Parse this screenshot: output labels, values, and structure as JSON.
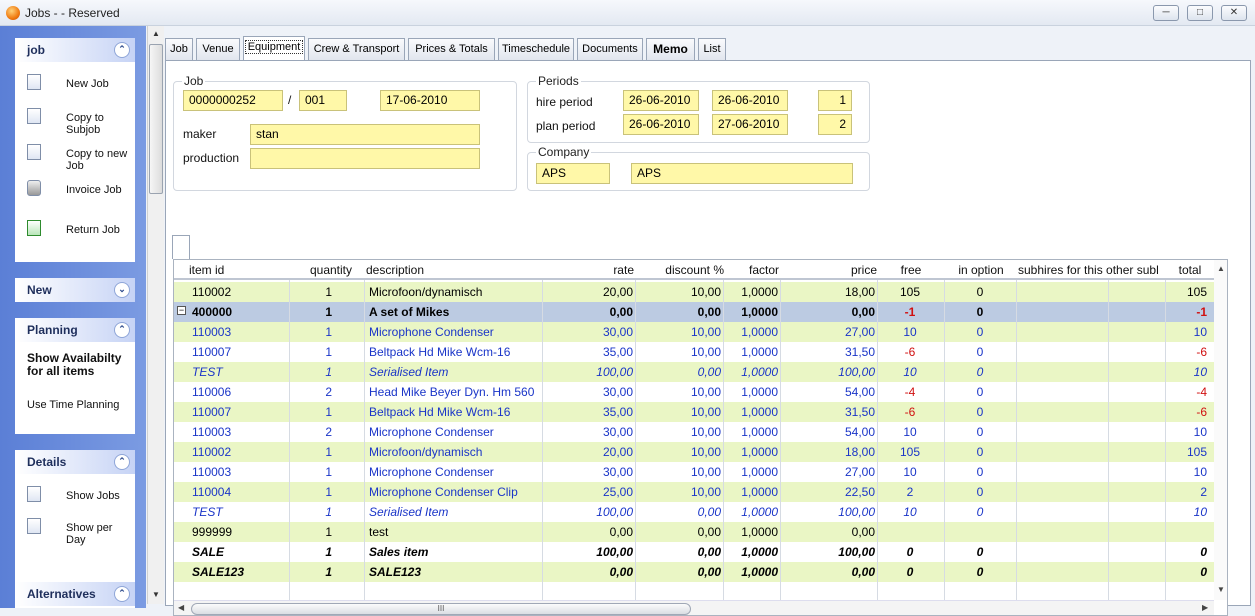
{
  "window": {
    "title": "Jobs -  - Reserved"
  },
  "taskpane": {
    "job": {
      "title": "job",
      "items": [
        "New Job",
        "Copy to Subjob",
        "Copy to new Job",
        "Invoice Job",
        "Return Job"
      ]
    },
    "new": {
      "title": "New"
    },
    "planning": {
      "title": "Planning",
      "show_availability": "Show Availabilty for all items",
      "use_time_planning": "Use Time Planning"
    },
    "details": {
      "title": "Details",
      "items": [
        "Show Jobs",
        "Show per Day"
      ]
    },
    "alternatives": {
      "title": "Alternatives"
    }
  },
  "tabs": [
    "Job",
    "Venue",
    "Equipment",
    "Crew & Transport",
    "Prices & Totals",
    "Timeschedule",
    "Documents",
    "Memo",
    "List"
  ],
  "active_tab": "Equipment",
  "job": {
    "group_label": "Job",
    "number": "0000000252",
    "separator": "/",
    "sub": "001",
    "date": "17-06-2010",
    "maker_label": "maker",
    "maker": "stan",
    "production_label": "production",
    "production": ""
  },
  "periods": {
    "group_label": "Periods",
    "hire_label": "hire period",
    "hire_from": "26-06-2010",
    "hire_to": "26-06-2010",
    "hire_days": "1",
    "plan_label": "plan period",
    "plan_from": "26-06-2010",
    "plan_to": "27-06-2010",
    "plan_days": "2"
  },
  "company": {
    "group_label": "Company",
    "code": "APS",
    "name": "APS"
  },
  "grid": {
    "columns": [
      "item id",
      "quantity",
      "description",
      "rate",
      "discount %",
      "factor",
      "price",
      "free",
      "in option",
      "subhires for this other subl",
      "total"
    ],
    "rows": [
      {
        "id": "110002",
        "qty": "1",
        "desc": "Microfoon/dynamisch",
        "rate": "20,00",
        "disc": "10,00",
        "factor": "1,0000",
        "price": "18,00",
        "free": "105",
        "opt": "0",
        "total": "105",
        "style": ""
      },
      {
        "id": "400000",
        "qty": "1",
        "desc": "A set of Mikes",
        "rate": "0,00",
        "disc": "0,00",
        "factor": "1,0000",
        "price": "0,00",
        "free": "-1",
        "opt": "0",
        "total": "-1",
        "style": "sel b"
      },
      {
        "id": "110003",
        "qty": "1",
        "desc": "Microphone Condenser",
        "rate": "30,00",
        "disc": "10,00",
        "factor": "1,0000",
        "price": "27,00",
        "free": "10",
        "opt": "0",
        "total": "10",
        "style": "blue"
      },
      {
        "id": "110007",
        "qty": "1",
        "desc": "Beltpack Hd Mike Wcm-16",
        "rate": "35,00",
        "disc": "10,00",
        "factor": "1,0000",
        "price": "31,50",
        "free": "-6",
        "opt": "0",
        "total": "-6",
        "style": "blue"
      },
      {
        "id": "TEST",
        "qty": "1",
        "desc": "Serialised Item",
        "rate": "100,00",
        "disc": "0,00",
        "factor": "1,0000",
        "price": "100,00",
        "free": "10",
        "opt": "0",
        "total": "10",
        "style": "blue ital"
      },
      {
        "id": "110006",
        "qty": "2",
        "desc": "Head Mike Beyer Dyn. Hm 560",
        "rate": "30,00",
        "disc": "10,00",
        "factor": "1,0000",
        "price": "54,00",
        "free": "-4",
        "opt": "0",
        "total": "-4",
        "style": "blue"
      },
      {
        "id": "110007",
        "qty": "1",
        "desc": "Beltpack Hd Mike Wcm-16",
        "rate": "35,00",
        "disc": "10,00",
        "factor": "1,0000",
        "price": "31,50",
        "free": "-6",
        "opt": "0",
        "total": "-6",
        "style": "blue"
      },
      {
        "id": "110003",
        "qty": "2",
        "desc": "Microphone Condenser",
        "rate": "30,00",
        "disc": "10,00",
        "factor": "1,0000",
        "price": "54,00",
        "free": "10",
        "opt": "0",
        "total": "10",
        "style": "blue"
      },
      {
        "id": "110002",
        "qty": "1",
        "desc": "Microfoon/dynamisch",
        "rate": "20,00",
        "disc": "10,00",
        "factor": "1,0000",
        "price": "18,00",
        "free": "105",
        "opt": "0",
        "total": "105",
        "style": "blue"
      },
      {
        "id": "110003",
        "qty": "1",
        "desc": "Microphone Condenser",
        "rate": "30,00",
        "disc": "10,00",
        "factor": "1,0000",
        "price": "27,00",
        "free": "10",
        "opt": "0",
        "total": "10",
        "style": "blue"
      },
      {
        "id": "110004",
        "qty": "1",
        "desc": "Microphone Condenser Clip",
        "rate": "25,00",
        "disc": "10,00",
        "factor": "1,0000",
        "price": "22,50",
        "free": "2",
        "opt": "0",
        "total": "2",
        "style": "blue"
      },
      {
        "id": "TEST",
        "qty": "1",
        "desc": "Serialised Item",
        "rate": "100,00",
        "disc": "0,00",
        "factor": "1,0000",
        "price": "100,00",
        "free": "10",
        "opt": "0",
        "total": "10",
        "style": "blue ital"
      },
      {
        "id": "999999",
        "qty": "1",
        "desc": "test",
        "rate": "0,00",
        "disc": "0,00",
        "factor": "1,0000",
        "price": "0,00",
        "free": "",
        "opt": "",
        "total": "",
        "style": ""
      },
      {
        "id": "SALE",
        "qty": "1",
        "desc": "Sales item",
        "rate": "100,00",
        "disc": "0,00",
        "factor": "1,0000",
        "price": "100,00",
        "free": "0",
        "opt": "0",
        "total": "0",
        "style": "b ital"
      },
      {
        "id": "SALE123",
        "qty": "1",
        "desc": "SALE123",
        "rate": "0,00",
        "disc": "0,00",
        "factor": "1,0000",
        "price": "0,00",
        "free": "0",
        "opt": "0",
        "total": "0",
        "style": "b ital"
      }
    ],
    "hscroll_grip": "III"
  }
}
